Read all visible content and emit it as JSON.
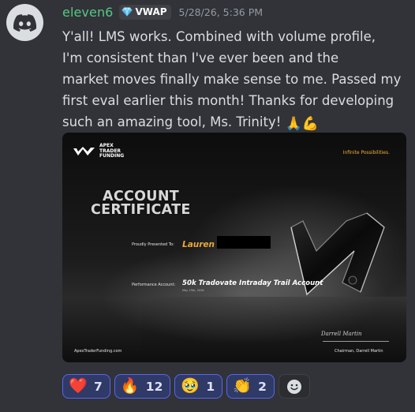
{
  "author": {
    "username": "eleven6",
    "username_color": "#57c785",
    "avatar_icon": "discord-logo-icon",
    "role_tag": {
      "icon": "gem-icon",
      "label": "VWAP"
    },
    "timestamp": "5/28/26, 5:36 PM"
  },
  "message": {
    "lines": [
      "Y'all! LMS works. Combined with volume profile,",
      "I'm consistent than I've ever been and the",
      "market moves finally make sense to me. Passed my",
      "first eval earlier this month! Thanks for developing",
      "such an amazing tool, Ms. Trinity!"
    ],
    "trailing_emojis": [
      "🙏",
      "💪"
    ]
  },
  "attachment": {
    "type": "image",
    "logo_text": "APEX TRADER FUNDING",
    "tagline": "Infinite Possibilities.",
    "title_line1": "ACCOUNT",
    "title_line2": "CERTIFICATE",
    "presented_label": "Proudly Presented To:",
    "recipient_name": "Lauren",
    "account_label": "Performance Account:",
    "account_value": "50k Tradovate Intraday Trail Account",
    "issue_date": "May 15th, 2026",
    "website": "ApexTraderFunding.com",
    "signature": "Darrell Martin",
    "signer_title": "Chairman, Darrell Martin"
  },
  "reactions": [
    {
      "emoji": "❤️",
      "name": "heart",
      "count": "7"
    },
    {
      "emoji": "🔥",
      "name": "fire",
      "count": "12"
    },
    {
      "emoji": "🥹",
      "name": "holding-back-tears",
      "count": "1"
    },
    {
      "emoji": "👏",
      "name": "clapping-hands",
      "count": "2"
    }
  ],
  "add_reaction_icon": "add-reaction-icon",
  "colors": {
    "background": "#313338",
    "reaction_bg": "#2f3a67",
    "reaction_border": "#5865f2",
    "accent_gold": "#f3b13b"
  }
}
